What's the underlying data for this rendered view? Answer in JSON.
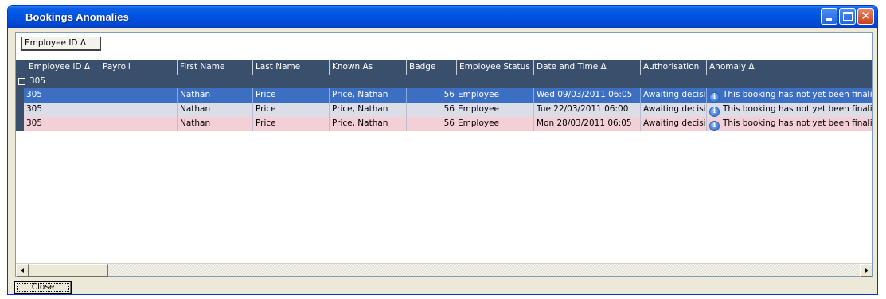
{
  "window": {
    "title": "Bookings Anomalies"
  },
  "group_by": {
    "chip_label": "Employee ID Δ"
  },
  "columns": [
    {
      "label": "Employee ID Δ"
    },
    {
      "label": "Payroll"
    },
    {
      "label": "First Name"
    },
    {
      "label": "Last Name"
    },
    {
      "label": "Known As"
    },
    {
      "label": "Badge"
    },
    {
      "label": "Employee Status"
    },
    {
      "label": "Date and Time Δ"
    },
    {
      "label": "Authorisation"
    },
    {
      "label": "Anomaly Δ"
    }
  ],
  "group": {
    "label": "305"
  },
  "rows": [
    {
      "employee_id": "305",
      "payroll": "",
      "first_name": "Nathan",
      "last_name": "Price",
      "known_as": "Price, Nathan",
      "badge": "56",
      "status": "Employee",
      "date_time": "Wed 09/03/2011 06:05",
      "authorisation": "Awaiting decision",
      "anomaly": "This booking has not yet been finalised."
    },
    {
      "employee_id": "305",
      "payroll": "",
      "first_name": "Nathan",
      "last_name": "Price",
      "known_as": "Price, Nathan",
      "badge": "56",
      "status": "Employee",
      "date_time": "Tue 22/03/2011 06:00",
      "authorisation": "Awaiting decision",
      "anomaly": "This booking has not yet been finalised."
    },
    {
      "employee_id": "305",
      "payroll": "",
      "first_name": "Nathan",
      "last_name": "Price",
      "known_as": "Price, Nathan",
      "badge": "56",
      "status": "Employee",
      "date_time": "Mon 28/03/2011 06:05",
      "authorisation": "Awaiting decision",
      "anomaly": "This booking has not yet been finalised."
    }
  ],
  "buttons": {
    "close_label": "Close"
  },
  "icons": {
    "anomaly_icon": "info-icon",
    "window_controls": [
      "minimize-icon",
      "maximize-icon",
      "close-icon"
    ]
  },
  "colors": {
    "title_bar": "#0054e3",
    "header_bg": "#3a4f6c",
    "selected_row": "#3c6fc2",
    "row_alt": "#dcdde6",
    "row_highlight": "#f3cfd6"
  }
}
